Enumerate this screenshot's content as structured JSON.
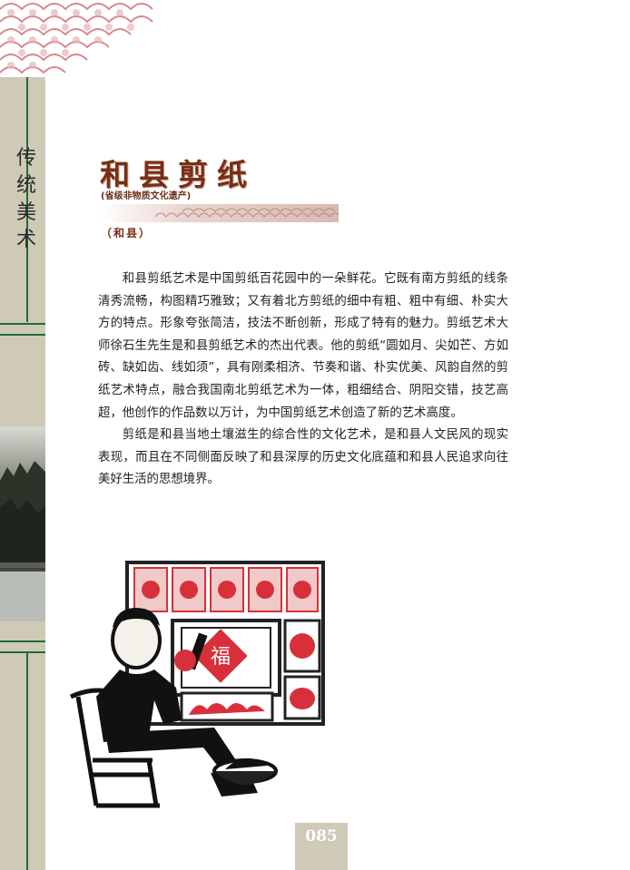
{
  "sidebar": {
    "category": [
      "传",
      "统",
      "美",
      "术"
    ]
  },
  "article": {
    "title": "和县剪纸",
    "subtitle": "(省级非物质文化遗产)",
    "location": "（和县）",
    "paragraphs": [
      "和县剪纸艺术是中国剪纸百花园中的一朵鲜花。它既有南方剪纸的线条清秀流畅，构图精巧雅致；又有着北方剪纸的细中有粗、粗中有细、朴实大方的特点。形象夸张简洁，技法不断创新，形成了特有的魅力。剪纸艺术大师徐石生先生是和县剪纸艺术的杰出代表。他的剪纸“圆如月、尖如芒、方如砖、缺如齿、线如须”，具有刚柔相济、节奏和谐、朴实优美、风韵自然的剪纸艺术特点，融合我国南北剪纸艺术为一体，粗细结合、阴阳交错，技艺高超，他创作的作品数以万计，为中国剪纸艺术创造了新的艺术高度。",
      "剪纸是和县当地土壤滋生的综合性的文化艺术，是和县人文民风的现实表现，而且在不同侧面反映了和县深厚的历史文化底蕴和和县人民追求向往美好生活的思想境界。"
    ]
  },
  "page": {
    "number": "085"
  },
  "colors": {
    "accent_green": "#1f6b3a",
    "title_brown": "#7a2e18",
    "sidebar_beige": "#cfcab6",
    "papercut_red": "#d8303a"
  }
}
